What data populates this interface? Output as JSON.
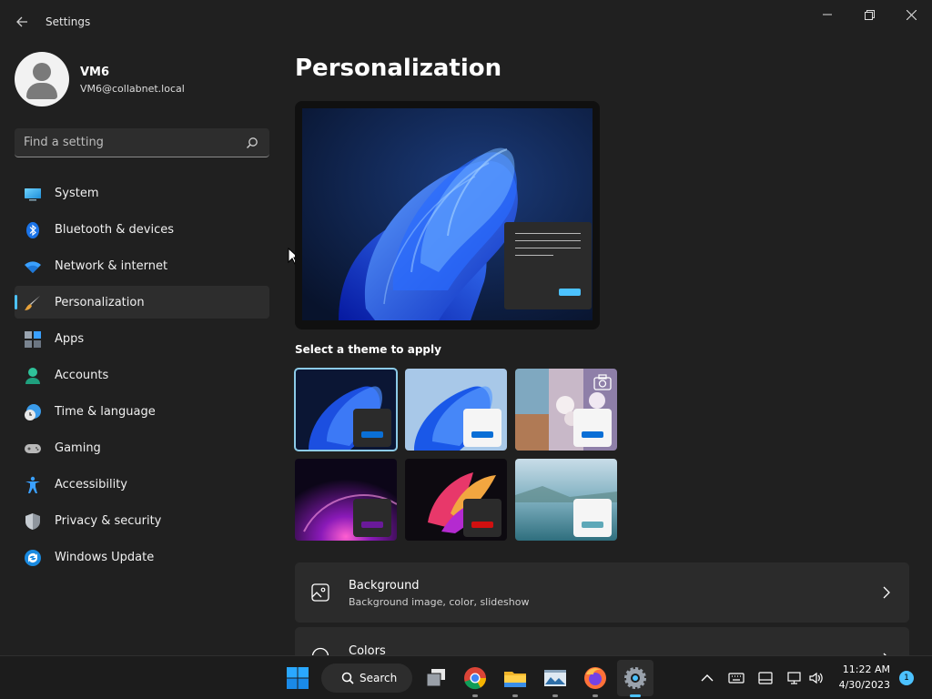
{
  "window": {
    "title": "Settings",
    "back_icon": "back-arrow-icon",
    "controls": {
      "minimize": "—",
      "maximize": "❐",
      "close": "✕"
    }
  },
  "user": {
    "name": "VM6",
    "email": "VM6@collabnet.local"
  },
  "search": {
    "placeholder": "Find a setting",
    "icon": "search-icon"
  },
  "sidebar": {
    "accent": "#4cc2ff",
    "active_index": 3,
    "items": [
      {
        "label": "System",
        "icon": "system-icon"
      },
      {
        "label": "Bluetooth & devices",
        "icon": "bluetooth-icon"
      },
      {
        "label": "Network & internet",
        "icon": "wifi-icon"
      },
      {
        "label": "Personalization",
        "icon": "brush-icon"
      },
      {
        "label": "Apps",
        "icon": "apps-icon"
      },
      {
        "label": "Accounts",
        "icon": "accounts-icon"
      },
      {
        "label": "Time & language",
        "icon": "clock-globe-icon"
      },
      {
        "label": "Gaming",
        "icon": "gamepad-icon"
      },
      {
        "label": "Accessibility",
        "icon": "accessibility-icon"
      },
      {
        "label": "Privacy & security",
        "icon": "shield-icon"
      },
      {
        "label": "Windows Update",
        "icon": "update-icon"
      }
    ]
  },
  "main": {
    "title": "Personalization",
    "themes_label": "Select a theme to apply",
    "themes": [
      {
        "name": "windows-dark",
        "selected": true,
        "accent": "#0a6fd6"
      },
      {
        "name": "windows-light",
        "selected": false,
        "accent": "#0a6fd6"
      },
      {
        "name": "spotlight",
        "selected": false,
        "accent": "#0a6fd6"
      },
      {
        "name": "glow",
        "selected": false,
        "accent": "#6a1a9a"
      },
      {
        "name": "captured-motion",
        "selected": false,
        "accent": "#d01010"
      },
      {
        "name": "flow",
        "selected": false,
        "accent": "#5ea8b8"
      }
    ],
    "cards": [
      {
        "title": "Background",
        "subtitle": "Background image, color, slideshow",
        "icon": "image-icon"
      },
      {
        "title": "Colors",
        "subtitle": "",
        "icon": "palette-icon"
      }
    ]
  },
  "taskbar": {
    "search_label": "Search",
    "apps": [
      "start-icon",
      "task-view-icon",
      "chrome-icon",
      "file-explorer-icon",
      "image-viewer-icon",
      "firefox-icon",
      "settings-app-icon"
    ],
    "time": "11:22 AM",
    "date": "4/30/2023",
    "notification_count": "1"
  }
}
